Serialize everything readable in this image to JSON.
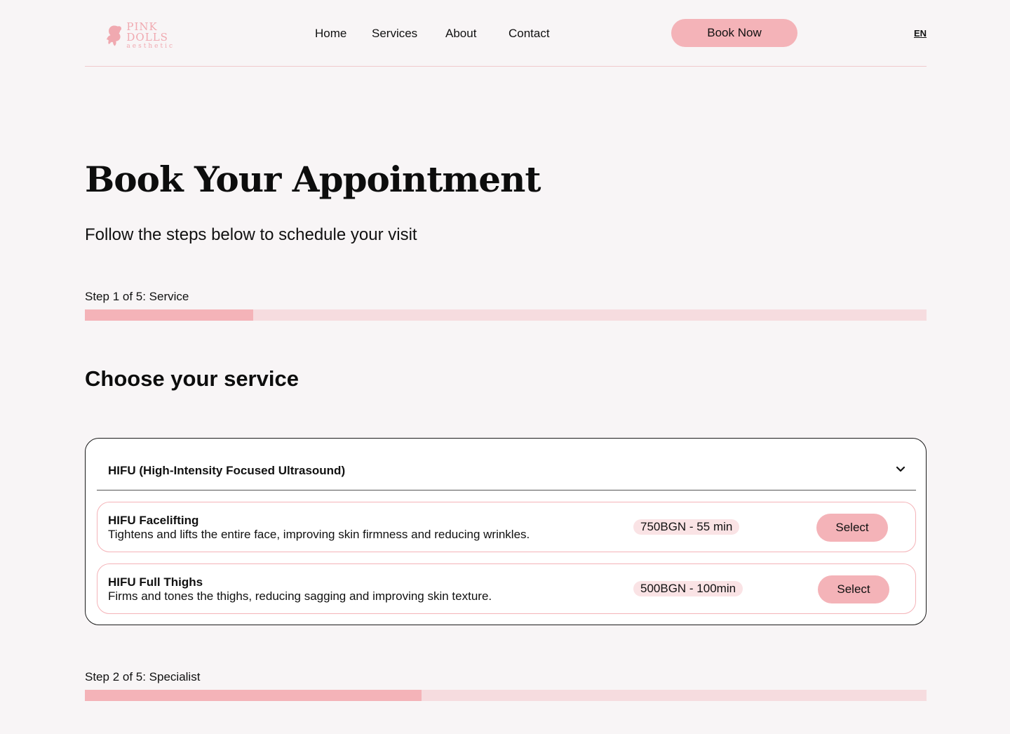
{
  "brand": {
    "logo_line1": "PINK",
    "logo_line2": "DOLLS",
    "logo_tagline": "aesthetic",
    "accent_color": "#f4b3b8",
    "light_accent_color": "#f6dcdf"
  },
  "nav": {
    "items": [
      {
        "label": "Home"
      },
      {
        "label": "Services"
      },
      {
        "label": "About"
      },
      {
        "label": "Contact"
      }
    ],
    "cta_label": "Book Now",
    "language": "EN"
  },
  "hero": {
    "title": "Book Your Appointment",
    "subtitle": "Follow the steps below to schedule your visit"
  },
  "steps": [
    {
      "label": "Step 1 of 5: Service",
      "progress": 0.2
    },
    {
      "label": "Step 2 of 5: Specialist",
      "progress": 0.4
    }
  ],
  "service_section": {
    "title": "Choose your service",
    "category": {
      "label": "HIFU (High-Intensity Focused Ultrasound)",
      "icon": "chevron-down-icon",
      "expanded": true
    },
    "items": [
      {
        "name": "HIFU Facelifting",
        "description": "Tightens and lifts the entire face, improving skin firmness and reducing wrinkles.",
        "price_duration": "750BGN - 55 min",
        "button_label": "Select"
      },
      {
        "name": "HIFU Full Thighs",
        "description": "Firms and tones the thighs, reducing sagging and improving skin texture.",
        "price_duration": "500BGN - 100min",
        "button_label": "Select"
      }
    ]
  }
}
